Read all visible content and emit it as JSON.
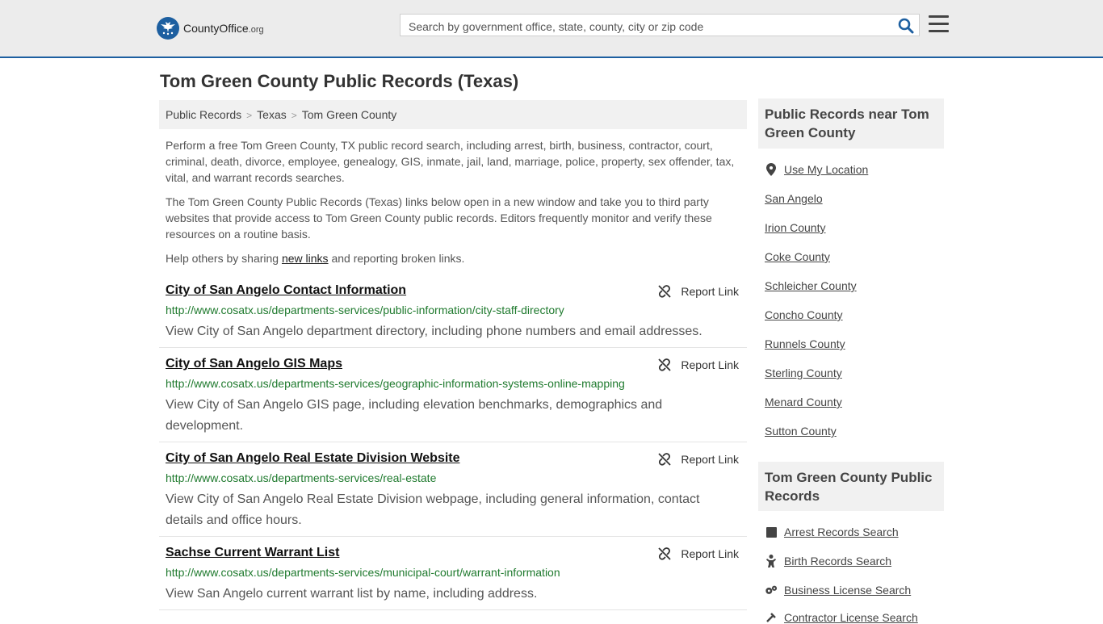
{
  "header": {
    "logo_text": "CountyOffice",
    "logo_tld": ".org",
    "search_placeholder": "Search by government office, state, county, city or zip code"
  },
  "page": {
    "title": "Tom Green County Public Records (Texas)"
  },
  "breadcrumb": [
    "Public Records",
    "Texas",
    "Tom Green County"
  ],
  "intro": {
    "p1": "Perform a free Tom Green County, TX public record search, including arrest, birth, business, contractor, court, criminal, death, divorce, employee, genealogy, GIS, inmate, jail, land, marriage, police, property, sex offender, tax, vital, and warrant records searches.",
    "p2": "The Tom Green County Public Records (Texas) links below open in a new window and take you to third party websites that provide access to Tom Green County public records. Editors frequently monitor and verify these resources on a routine basis.",
    "p3_before": "Help others by sharing ",
    "p3_link": "new links",
    "p3_after": " and reporting broken links."
  },
  "report_label": "Report Link",
  "records": [
    {
      "title": "City of San Angelo Contact Information",
      "url": "http://www.cosatx.us/departments-services/public-information/city-staff-directory",
      "desc": "View City of San Angelo department directory, including phone numbers and email addresses."
    },
    {
      "title": "City of San Angelo GIS Maps",
      "url": "http://www.cosatx.us/departments-services/geographic-information-systems-online-mapping",
      "desc": "View City of San Angelo GIS page, including elevation benchmarks, demographics and development."
    },
    {
      "title": "City of San Angelo Real Estate Division Website",
      "url": "http://www.cosatx.us/departments-services/real-estate",
      "desc": "View City of San Angelo Real Estate Division webpage, including general information, contact details and office hours."
    },
    {
      "title": "Sachse Current Warrant List",
      "url": "http://www.cosatx.us/departments-services/municipal-court/warrant-information",
      "desc": "View San Angelo current warrant list by name, including address."
    }
  ],
  "sidebar": {
    "near_title": "Public Records near Tom Green County",
    "use_location": "Use My Location",
    "near_links": [
      "San Angelo",
      "Irion County",
      "Coke County",
      "Schleicher County",
      "Concho County",
      "Runnels County",
      "Sterling County",
      "Menard County",
      "Sutton County"
    ],
    "records_title": "Tom Green County Public Records",
    "record_links": [
      {
        "label": "Arrest Records Search",
        "icon": "square-icon"
      },
      {
        "label": "Birth Records Search",
        "icon": "baby-icon"
      },
      {
        "label": "Business License Search",
        "icon": "gears-icon"
      },
      {
        "label": "Contractor License Search",
        "icon": "tools-icon"
      }
    ]
  },
  "colors": {
    "brand_blue": "#1d5fa0",
    "url_green": "#1f7a2e"
  }
}
